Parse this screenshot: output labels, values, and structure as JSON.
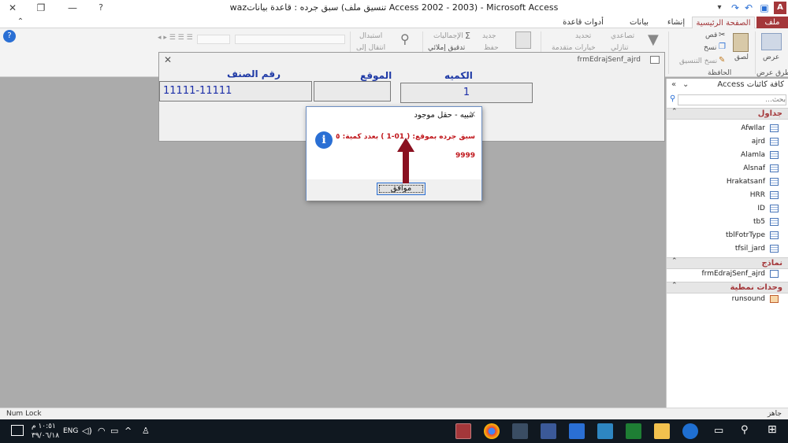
{
  "window": {
    "title": "wazسبق جرده : قاعدة بيانات (تنسيق ملف Access 2002 - 2003)  -  Microsoft Access",
    "colors": {
      "accent": "#a4373a"
    }
  },
  "tabs": {
    "file": "ملف",
    "home": "الصفحة الرئيسية",
    "create": "إنشاء",
    "external": "بيانات خارجية",
    "dbtools": "أدوات قاعدة البيانات"
  },
  "ribbon": {
    "views_label": "عرض",
    "views_group": "طرق عرض",
    "paste_label": "لصق",
    "cut": "قص",
    "copy": "نسخ",
    "format_painter": "نسخ التنسيق",
    "clipboard_group": "الحافظة",
    "sort_asc": "تصاعدي",
    "sort_desc": "تنازلي",
    "selection": "تحديد",
    "advanced": "خيارات متقدمة",
    "new": "جديد",
    "save": "حفظ",
    "totals": "الإجماليات",
    "spelling": "تدقيق إملائي",
    "replace": "استبدال",
    "goto": "انتقال إلى"
  },
  "form": {
    "title": "frmEdrajSenf_ajrd",
    "labels": {
      "qty": "الكميه",
      "location": "الموقع",
      "code": "رقم الصنف"
    },
    "values": {
      "qty": "1",
      "location": "",
      "code": "11111-11111"
    }
  },
  "dialog": {
    "title": "تنبيه - حقل موجود",
    "message": "سبق جرده بموقع: ( 01-1 ) بعدد كمية: ٥",
    "message2": "9999",
    "ok": "موافق"
  },
  "nav": {
    "title": "كافة كائنات Access",
    "search_placeholder": "بحث...",
    "sections": {
      "tables": "جداول",
      "forms": "نماذج",
      "modules": "وحدات نمطية"
    },
    "tables": [
      "AfwIlar",
      "ajrd",
      "Alamla",
      "Alsnaf",
      "Hrakatsanf",
      "HRR",
      "ID",
      "tb5",
      "tblFotrType",
      "tfsil_jard"
    ],
    "forms": [
      "frmEdrajSenf_ajrd"
    ],
    "modules": [
      "runsound"
    ]
  },
  "status": {
    "left": "Num Lock",
    "right": "جاهز"
  },
  "taskbar": {
    "lang": "ENG",
    "time": "١٠:٥١ م",
    "date": "٣٩/٠٦/١٨"
  }
}
